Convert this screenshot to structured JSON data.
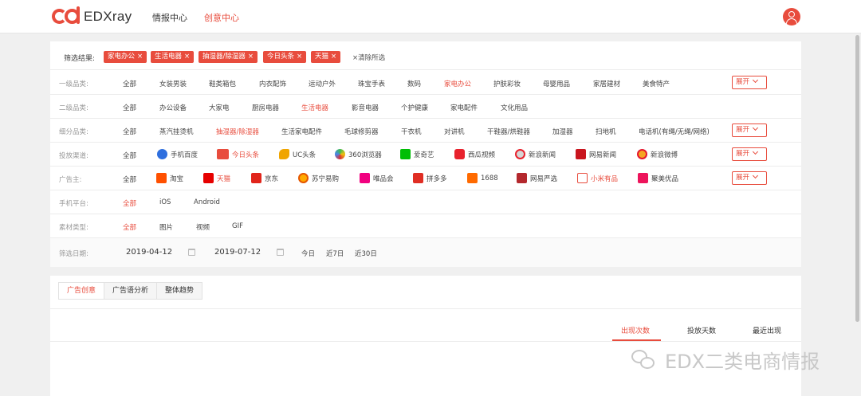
{
  "header": {
    "logo_text": "EDXray",
    "nav": [
      "情报中心",
      "创意中心"
    ],
    "active_nav": "创意中心"
  },
  "filter_result": {
    "label": "筛选结果:",
    "tags": [
      "家电办公",
      "生活电器",
      "抽湿器/除湿器",
      "今日头条",
      "天猫"
    ],
    "tag_remove_glyph": "×",
    "clear_all": "×清除所选"
  },
  "filters": {
    "category_l1": {
      "label": "一级品类:",
      "options": [
        "全部",
        "女装男装",
        "鞋类箱包",
        "内衣配饰",
        "运动户外",
        "珠宝手表",
        "数码",
        "家电办公",
        "护肤彩妆",
        "母婴用品",
        "家居建材",
        "美食特产"
      ],
      "selected": "家电办公",
      "expand": "展开"
    },
    "category_l2": {
      "label": "二级品类:",
      "options": [
        "全部",
        "办公设备",
        "大家电",
        "厨房电器",
        "生活电器",
        "影音电器",
        "个护健康",
        "家电配件",
        "文化用品"
      ],
      "selected": "生活电器"
    },
    "category_detail": {
      "label": "细分品类:",
      "options": [
        "全部",
        "蒸汽挂烫机",
        "抽湿器/除湿器",
        "生活家电配件",
        "毛球修剪器",
        "干衣机",
        "对讲机",
        "干鞋器/烘鞋器",
        "加湿器",
        "扫地机",
        "电话机(有绳/无绳/网络)"
      ],
      "selected": "抽湿器/除湿器",
      "expand": "展开"
    },
    "channel": {
      "label": "投放渠道:",
      "options": [
        "全部",
        "手机百度",
        "今日头条",
        "UC头条",
        "360浏览器",
        "爱奇艺",
        "西瓜视频",
        "新浪新闻",
        "网易新闻",
        "新浪微博"
      ],
      "selected": "今日头条",
      "expand": "展开"
    },
    "advertiser": {
      "label": "广告主:",
      "options": [
        "全部",
        "淘宝",
        "天猫",
        "京东",
        "苏宁易购",
        "唯品会",
        "拼多多",
        "1688",
        "网易严选",
        "小米有品",
        "聚美优品"
      ],
      "selected": [
        "天猫",
        "小米有品"
      ],
      "expand": "展开"
    },
    "platform": {
      "label": "手机平台:",
      "options": [
        "全部",
        "iOS",
        "Android"
      ],
      "selected": "全部"
    },
    "material": {
      "label": "素材类型:",
      "options": [
        "全部",
        "图片",
        "视频",
        "GIF"
      ],
      "selected": "全部"
    }
  },
  "date_filter": {
    "label": "筛选日期:",
    "start": "2019-04-12",
    "end": "2019-07-12",
    "quick": [
      "今日",
      "近7日",
      "近30日"
    ]
  },
  "tabs": {
    "items": [
      "广告创意",
      "广告语分析",
      "整体趋势"
    ],
    "active": "广告创意"
  },
  "sort": {
    "items": [
      "出现次数",
      "投放天数",
      "最近出现"
    ],
    "active": "出现次数"
  },
  "watermark": "EDX二类电商情报",
  "colors": {
    "accent": "#e84c3d",
    "background": "#f0f0f0"
  },
  "icons": {
    "channel": [
      "baidu-paw-icon",
      "toutiao-icon",
      "uc-squirrel-icon",
      "360-browser-icon",
      "iqiyi-icon",
      "xigua-video-icon",
      "sina-news-icon",
      "netease-news-icon",
      "weibo-icon"
    ],
    "advertiser": [
      "taobao-icon",
      "tmall-icon",
      "jd-icon",
      "suning-icon",
      "vip-icon",
      "pinduoduo-icon",
      "alibaba-1688-icon",
      "netease-yanxuan-icon",
      "xiaomi-youpin-icon",
      "jumei-icon"
    ]
  }
}
